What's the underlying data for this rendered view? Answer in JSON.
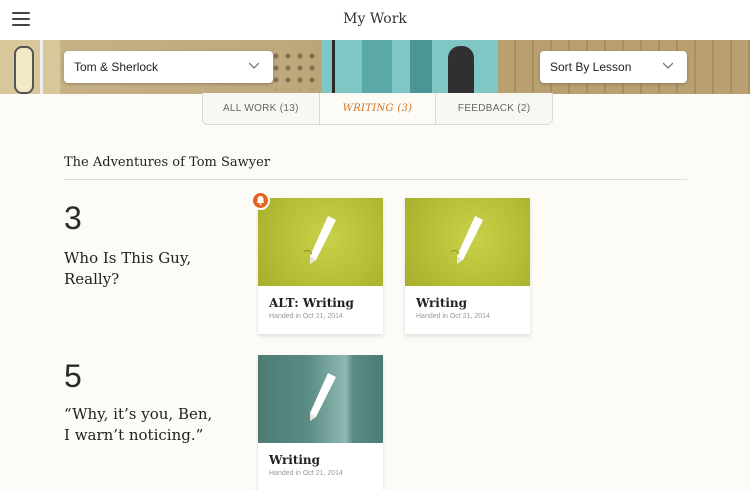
{
  "header": {
    "title": "My Work",
    "menu_icon": "hamburger-menu-icon"
  },
  "filters": {
    "book": {
      "selected": "Tom & Sherlock"
    },
    "sort": {
      "selected": "Sort By Lesson"
    }
  },
  "tabs": [
    {
      "label": "ALL WORK (13)",
      "active": false
    },
    {
      "label": "WRITING (3)",
      "active": true
    },
    {
      "label": "FEEDBACK (2)",
      "active": false
    }
  ],
  "book_title": "The Adventures of Tom Sawyer",
  "lessons": [
    {
      "number": "3",
      "title": "Who Is This Guy, Really?",
      "cards": [
        {
          "title": "ALT: Writing",
          "date": "Handed in Oct 21, 2014",
          "thumb_color": "#b8c037",
          "icon": "pencil-icon",
          "notification": true
        },
        {
          "title": "Writing",
          "date": "Handed in Oct 21, 2014",
          "thumb_color": "#b8c037",
          "icon": "pencil-icon",
          "notification": false
        }
      ]
    },
    {
      "number": "5",
      "title": "“Why, it’s you, Ben, I warn’t noticing.”",
      "cards": [
        {
          "title": "Writing",
          "date": "Handed in Oct 21, 2014",
          "thumb_color": "#5a8c84",
          "icon": "pencil-icon",
          "notification": false
        }
      ]
    }
  ],
  "colors": {
    "accent": "#d2762a",
    "alert": "#e8621f",
    "background": "#fcfbf6"
  }
}
